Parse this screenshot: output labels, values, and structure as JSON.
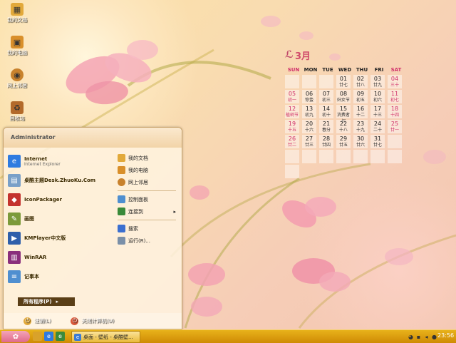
{
  "desktop": {
    "icons": [
      {
        "label": "我的文档",
        "icon": "folder-icon",
        "color": "#e2a93a"
      },
      {
        "label": "我的电脑",
        "icon": "computer-icon",
        "color": "#d98f2a"
      },
      {
        "label": "网上邻居",
        "icon": "network-icon",
        "color": "#c8822d"
      },
      {
        "label": "回收站",
        "icon": "recycle-bin-icon",
        "color": "#b36a2a"
      }
    ]
  },
  "calendar": {
    "month_label": "3月",
    "weekdays": [
      "SUN",
      "MON",
      "TUE",
      "WED",
      "THU",
      "FRI",
      "SAT"
    ],
    "weekday_colors": [
      "#d0306a",
      "#222222",
      "#222222",
      "#222222",
      "#222222",
      "#222222",
      "#d0306a"
    ],
    "days": [
      {
        "d": "",
        "l": ""
      },
      {
        "d": "",
        "l": ""
      },
      {
        "d": "",
        "l": ""
      },
      {
        "d": "01",
        "l": "廿七"
      },
      {
        "d": "02",
        "l": "廿八"
      },
      {
        "d": "03",
        "l": "廿九"
      },
      {
        "d": "04",
        "l": "三十"
      },
      {
        "d": "05",
        "l": "初一"
      },
      {
        "d": "06",
        "l": "惊蛰"
      },
      {
        "d": "07",
        "l": "初三"
      },
      {
        "d": "08",
        "l": "妇女节"
      },
      {
        "d": "09",
        "l": "初五"
      },
      {
        "d": "10",
        "l": "初六"
      },
      {
        "d": "11",
        "l": "初七"
      },
      {
        "d": "12",
        "l": "植树节"
      },
      {
        "d": "13",
        "l": "初九"
      },
      {
        "d": "14",
        "l": "初十"
      },
      {
        "d": "15",
        "l": "消费者权"
      },
      {
        "d": "16",
        "l": "十二"
      },
      {
        "d": "17",
        "l": "十三"
      },
      {
        "d": "18",
        "l": "十四"
      },
      {
        "d": "19",
        "l": "十五"
      },
      {
        "d": "20",
        "l": "十六"
      },
      {
        "d": "21",
        "l": "春分"
      },
      {
        "d": "22",
        "l": "十八"
      },
      {
        "d": "23",
        "l": "十九"
      },
      {
        "d": "24",
        "l": "二十"
      },
      {
        "d": "25",
        "l": "廿一"
      },
      {
        "d": "26",
        "l": "廿二"
      },
      {
        "d": "27",
        "l": "廿三"
      },
      {
        "d": "28",
        "l": "廿四"
      },
      {
        "d": "29",
        "l": "廿五"
      },
      {
        "d": "30",
        "l": "廿六"
      },
      {
        "d": "31",
        "l": "廿七"
      },
      {
        "d": "",
        "l": ""
      },
      {
        "d": "",
        "l": ""
      },
      {
        "d": "",
        "l": ""
      },
      {
        "d": "",
        "l": ""
      },
      {
        "d": "",
        "l": ""
      },
      {
        "d": "",
        "l": ""
      },
      {
        "d": "",
        "l": ""
      },
      {
        "d": "",
        "l": ""
      },
      {
        "d": "",
        "l": ""
      }
    ]
  },
  "start_menu": {
    "user_name": "Administrator",
    "left_items": [
      {
        "title": "Internet",
        "subtitle": "Internet Explorer",
        "icon": "internet-explorer-icon",
        "color": "#2f7be0"
      },
      {
        "title": "桌酷主题Desk.ZhuoKu.Com",
        "subtitle": "",
        "icon": "zhuoku-theme-icon",
        "color": "#7aa0c8"
      },
      {
        "title": "IconPackager",
        "subtitle": "",
        "icon": "iconpackager-icon",
        "color": "#c4332e"
      },
      {
        "title": "画图",
        "subtitle": "",
        "icon": "paint-icon",
        "color": "#7c9a3a"
      },
      {
        "title": "KMPlayer中文版",
        "subtitle": "",
        "icon": "kmplayer-icon",
        "color": "#2f5faa"
      },
      {
        "title": "WinRAR",
        "subtitle": "",
        "icon": "winrar-icon",
        "color": "#8a2f7c"
      },
      {
        "title": "记事本",
        "subtitle": "",
        "icon": "notepad-icon",
        "color": "#4f8fd0"
      }
    ],
    "right_items": [
      {
        "label": "我的文档",
        "icon": "documents-icon",
        "color": "#e2a93a"
      },
      {
        "label": "我的电脑",
        "icon": "computer-icon",
        "color": "#d98f2a"
      },
      {
        "label": "网上邻居",
        "icon": "network-icon",
        "color": "#c8822d"
      },
      {
        "label": "控制面板",
        "icon": "control-panel-icon",
        "color": "#4f8fd0"
      },
      {
        "label": "连接到",
        "icon": "connect-icon",
        "color": "#3a8a3a",
        "arrow": "▸"
      },
      {
        "label": "搜索",
        "icon": "search-icon",
        "color": "#3b6fd0"
      },
      {
        "label": "运行(R)...",
        "icon": "run-icon",
        "color": "#7a8fa8"
      }
    ],
    "all_programs": "所有程序(P)",
    "all_programs_arrow": "▸",
    "logoff": "注销(L)",
    "shutdown": "关闭计算机(U)"
  },
  "taskbar": {
    "task_label": "桌面 - 壁纸 - 桌酷壁...",
    "clock": "23:56"
  },
  "colors": {
    "accent_pink": "#d04a6a",
    "taskbar": "#e0a010"
  }
}
